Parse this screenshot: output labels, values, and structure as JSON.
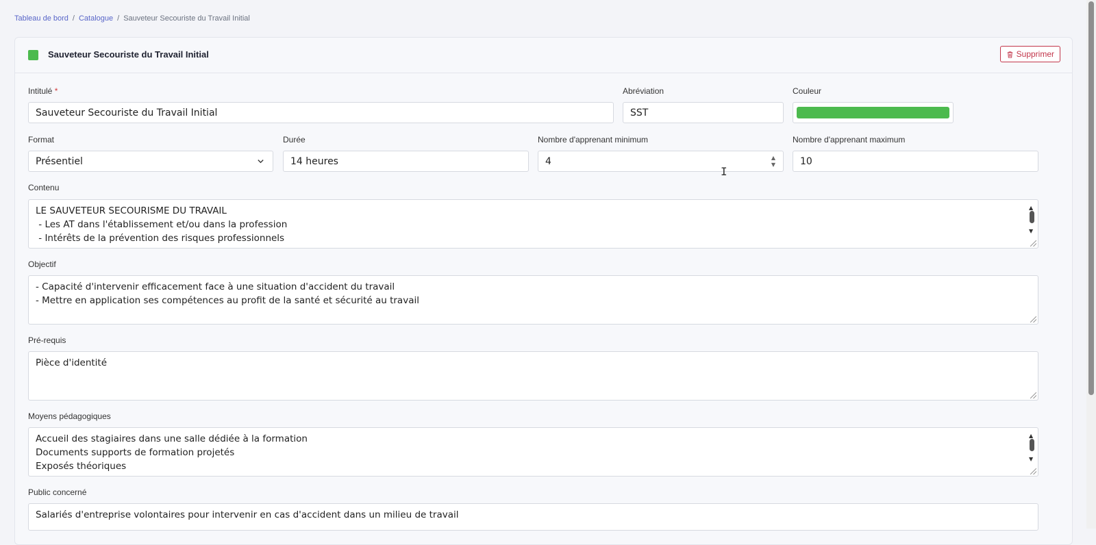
{
  "breadcrumb": {
    "home": "Tableau de bord",
    "catalog": "Catalogue",
    "current": "Sauveteur Secouriste du Travail Initial",
    "separator": "/"
  },
  "header": {
    "title": "Sauveteur Secouriste du Travail Initial",
    "color": "#4cba4e",
    "delete_label": "Supprimer"
  },
  "form": {
    "intitule": {
      "label": "Intitulé",
      "required_mark": "*",
      "value": "Sauveteur Secouriste du Travail Initial"
    },
    "abreviation": {
      "label": "Abréviation",
      "value": "SST"
    },
    "couleur": {
      "label": "Couleur",
      "value": "#4cba4e"
    },
    "format": {
      "label": "Format",
      "value": "Présentiel"
    },
    "duree": {
      "label": "Durée",
      "value": "14 heures"
    },
    "min": {
      "label": "Nombre d'apprenant minimum",
      "value": "4"
    },
    "max": {
      "label": "Nombre d'apprenant maximum",
      "value": "10"
    },
    "contenu": {
      "label": "Contenu",
      "lines": [
        "LE SAUVETEUR SECOURISME DU TRAVAIL",
        " - Les AT dans l'établissement et/ou dans la profession",
        " - Intérêts de la prévention des risques professionnels"
      ]
    },
    "objectif": {
      "label": "Objectif",
      "lines": [
        "- Capacité d'intervenir efficacement face à une situation d'accident du travail",
        "- Mettre en application ses compétences au profit de la santé et sécurité au travail"
      ]
    },
    "prerequis": {
      "label": "Pré-requis",
      "lines": [
        "Pièce d'identité"
      ]
    },
    "moyens": {
      "label": "Moyens pédagogiques",
      "lines": [
        "Accueil des stagiaires dans une salle dédiée à la formation",
        "Documents supports de formation projetés",
        "Exposés théoriques"
      ]
    },
    "public": {
      "label": "Public concerné",
      "lines": [
        "Salariés d'entreprise volontaires pour intervenir en cas d'accident dans un milieu de travail"
      ]
    }
  }
}
